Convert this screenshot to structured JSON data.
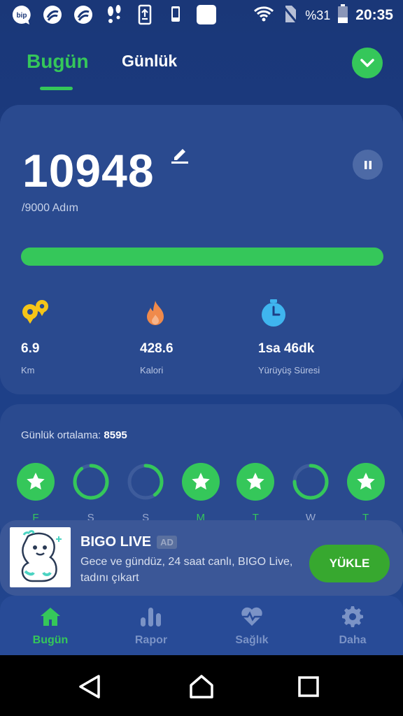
{
  "status_bar": {
    "battery_text": "%31",
    "time": "20:35",
    "icons": [
      "bip-icon",
      "turkcell-icon",
      "turkcell-icon",
      "footsteps-icon",
      "phone-update-icon",
      "phone-icon",
      "blank-square-icon",
      "wifi-icon",
      "no-sim-icon",
      "battery-icon"
    ]
  },
  "header": {
    "tab_today": "Bugün",
    "tab_daily": "Günlük",
    "dropdown_icon": "chevron-down-icon"
  },
  "steps": {
    "count": "10948",
    "goal_text": "/9000 Adım",
    "progress_fraction": 1.0,
    "stats": [
      {
        "value": "6.9",
        "label": "Km",
        "icon": "location-pins-icon"
      },
      {
        "value": "428.6",
        "label": "Kalori",
        "icon": "flame-icon"
      },
      {
        "value": "1sa 46dk",
        "label": "Yürüyüş Süresi",
        "icon": "stopwatch-icon"
      }
    ]
  },
  "weekly": {
    "avg_label": "Günlük ortalama:",
    "avg_value": "8595",
    "days": [
      {
        "label": "F",
        "status": "achieved"
      },
      {
        "label": "S",
        "status": "partial",
        "progress": 0.9
      },
      {
        "label": "S",
        "status": "partial",
        "progress": 0.4
      },
      {
        "label": "M",
        "status": "achieved"
      },
      {
        "label": "T",
        "status": "achieved"
      },
      {
        "label": "W",
        "status": "partial",
        "progress": 0.75
      },
      {
        "label": "T",
        "status": "achieved"
      }
    ]
  },
  "ad": {
    "title": "BIGO LIVE",
    "badge": "AD",
    "description": "Gece ve gündüz, 24 saat canlı, BIGO Live, tadını çıkart",
    "install_label": "YÜKLE"
  },
  "tab_bar": {
    "items": [
      {
        "label": "Bugün",
        "icon": "home-icon",
        "active": true
      },
      {
        "label": "Rapor",
        "icon": "bar-chart-icon",
        "active": false
      },
      {
        "label": "Sağlık",
        "icon": "heart-pulse-icon",
        "active": false
      },
      {
        "label": "Daha",
        "icon": "gear-icon",
        "active": false
      }
    ]
  },
  "colors": {
    "accent": "#35c75a",
    "background": "#1d3e86",
    "card": "#2a4a8f"
  }
}
